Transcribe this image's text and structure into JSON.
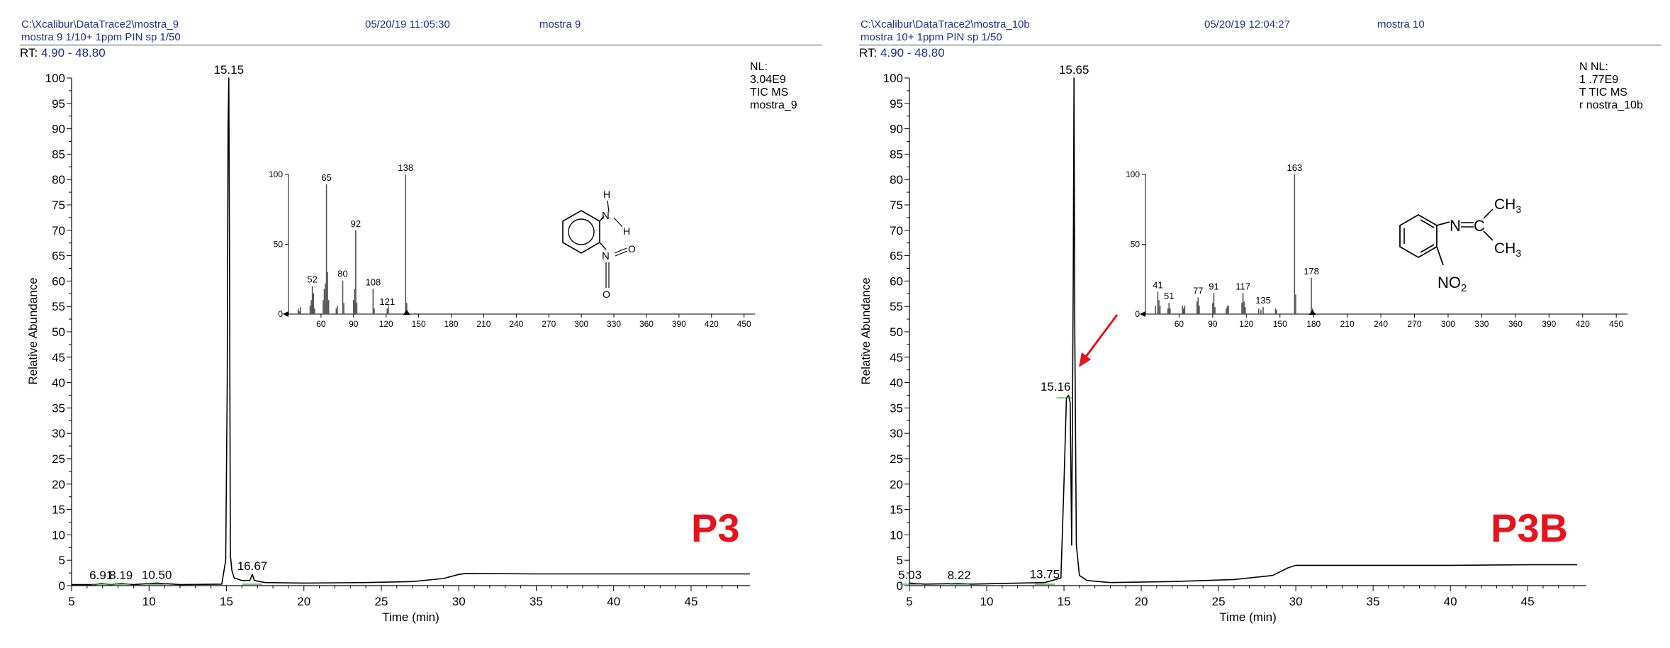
{
  "panels": [
    {
      "file_path": "C:\\Xcalibur\\DataTrace2\\mostra_9",
      "datetime": "05/20/19 11:05:30",
      "sample_name": "mostra 9",
      "description": "mostra 9 1/10+ 1ppm PIN sp 1/50",
      "rt_label": "RT:",
      "rt_range": "4.90 - 48.80",
      "nl_label": "NL:",
      "nl_value": "3.04E9",
      "scan_filter": "TIC  MS",
      "data_file": "mostra_9",
      "big_label": "P3",
      "structure": "2-nitroaniline",
      "chart_data": {
        "type": "line",
        "title": "",
        "xlabel": "Time (min)",
        "ylabel": "Relative Abundance",
        "xlim": [
          5,
          48.8
        ],
        "ylim": [
          0,
          100
        ],
        "xticks": [
          5,
          10,
          15,
          20,
          25,
          30,
          35,
          40,
          45
        ],
        "yticks": [
          0,
          5,
          10,
          15,
          20,
          25,
          30,
          35,
          40,
          45,
          50,
          55,
          60,
          65,
          70,
          75,
          80,
          85,
          90,
          95,
          100
        ],
        "series": [
          {
            "x": [
              5,
              6.5,
              6.91,
              7.5,
              8.19,
              9,
              10.5,
              12,
              14.7,
              14.95,
              15.05,
              15.1,
              15.15,
              15.2,
              15.25,
              15.35,
              15.5,
              16,
              16.5,
              16.67,
              16.8,
              17.5,
              20,
              24,
              27,
              29,
              30,
              30.5,
              35,
              40,
              45,
              48.8
            ],
            "y": [
              0.2,
              0.2,
              0.4,
              0.2,
              0.4,
              0.2,
              0.5,
              0.2,
              0.3,
              5,
              40,
              90,
              100,
              60,
              6,
              3,
              1.5,
              1,
              1,
              2.2,
              1,
              0.6,
              0.5,
              0.6,
              0.8,
              1.4,
              2.2,
              2.4,
              2.3,
              2.3,
              2.3,
              2.3
            ]
          }
        ],
        "peak_labels": [
          {
            "rt": 15.15,
            "abundance": 100,
            "text": "15.15"
          },
          {
            "rt": 6.91,
            "abundance": 0.4,
            "text": "6.91"
          },
          {
            "rt": 8.19,
            "abundance": 0.4,
            "text": "8.19"
          },
          {
            "rt": 10.5,
            "abundance": 0.5,
            "text": "10.50"
          },
          {
            "rt": 16.67,
            "abundance": 2.2,
            "text": "16.67"
          }
        ]
      },
      "inset_chart_data": {
        "type": "bar",
        "xlim": [
          30,
          460
        ],
        "ylim": [
          0,
          100
        ],
        "xticks": [
          60,
          90,
          120,
          150,
          180,
          210,
          240,
          270,
          300,
          330,
          360,
          390,
          420,
          450
        ],
        "yticks": [
          0,
          50,
          100
        ],
        "peaks": [
          {
            "mz": 39,
            "rel": 4
          },
          {
            "mz": 40,
            "rel": 2
          },
          {
            "mz": 41,
            "rel": 5
          },
          {
            "mz": 50,
            "rel": 6
          },
          {
            "mz": 51,
            "rel": 10
          },
          {
            "mz": 52,
            "rel": 20
          },
          {
            "mz": 53,
            "rel": 15
          },
          {
            "mz": 54,
            "rel": 4
          },
          {
            "mz": 62,
            "rel": 10
          },
          {
            "mz": 63,
            "rel": 18
          },
          {
            "mz": 64,
            "rel": 22
          },
          {
            "mz": 65,
            "rel": 93
          },
          {
            "mz": 66,
            "rel": 30
          },
          {
            "mz": 67,
            "rel": 10
          },
          {
            "mz": 74,
            "rel": 4
          },
          {
            "mz": 75,
            "rel": 6
          },
          {
            "mz": 80,
            "rel": 24
          },
          {
            "mz": 81,
            "rel": 8
          },
          {
            "mz": 90,
            "rel": 10
          },
          {
            "mz": 91,
            "rel": 18
          },
          {
            "mz": 92,
            "rel": 60
          },
          {
            "mz": 93,
            "rel": 8
          },
          {
            "mz": 108,
            "rel": 18
          },
          {
            "mz": 109,
            "rel": 4
          },
          {
            "mz": 121,
            "rel": 4
          },
          {
            "mz": 122,
            "rel": 6
          },
          {
            "mz": 138,
            "rel": 100
          },
          {
            "mz": 139,
            "rel": 8
          }
        ],
        "peak_labels": [
          {
            "mz": 52,
            "text": "52"
          },
          {
            "mz": 65,
            "text": "65"
          },
          {
            "mz": 80,
            "text": "80"
          },
          {
            "mz": 92,
            "text": "92"
          },
          {
            "mz": 108,
            "text": "108"
          },
          {
            "mz": 121,
            "text": "121"
          },
          {
            "mz": 138,
            "text": "138"
          }
        ]
      }
    },
    {
      "file_path": "C:\\Xcalibur\\DataTrace2\\mostra_10b",
      "datetime": "05/20/19 12:04:27",
      "sample_name": "mostra 10",
      "description": "mostra 10+ 1ppm PIN sp 1/50",
      "rt_label": "RT:",
      "rt_range": "4.90 - 48.80",
      "nl_label": "N  NL:",
      "nl_value": "1  .77E9",
      "scan_filter": "T  TIC  MS",
      "data_file": "r  nostra_10b",
      "big_label": "P3B",
      "structure": "N-(2-nitrophenyl)propan-2-imine",
      "chart_data": {
        "type": "line",
        "title": "",
        "xlabel": "Time (min)",
        "ylabel": "Relative Abundance",
        "xlim": [
          5,
          48.8
        ],
        "ylim": [
          0,
          100
        ],
        "xticks": [
          5,
          10,
          15,
          20,
          25,
          30,
          35,
          40,
          45
        ],
        "yticks": [
          0,
          5,
          10,
          15,
          20,
          25,
          30,
          35,
          40,
          45,
          50,
          55,
          60,
          65,
          70,
          75,
          80,
          85,
          90,
          95,
          100
        ],
        "series": [
          {
            "x": [
              5,
              5.03,
              6,
              8.22,
              9,
              13.75,
              14.8,
              15.0,
              15.16,
              15.3,
              15.4,
              15.5,
              15.6,
              15.65,
              15.7,
              15.8,
              16.0,
              16.5,
              18,
              22,
              26,
              28.5,
              29.5,
              30,
              35,
              40,
              45,
              48.2
            ],
            "y": [
              0.3,
              0.5,
              0.3,
              0.4,
              0.3,
              0.6,
              1.5,
              20,
              37,
              37.5,
              36,
              8,
              60,
              100,
              50,
              8,
              2,
              1,
              0.6,
              0.8,
              1.2,
              2,
              3.5,
              4,
              4,
              4,
              4.1,
              4.1
            ]
          }
        ],
        "peak_labels": [
          {
            "rt": 15.65,
            "abundance": 100,
            "text": "15.65"
          },
          {
            "rt": 15.16,
            "abundance": 37,
            "text": "15.16"
          },
          {
            "rt": 5.03,
            "abundance": 0.5,
            "text": "5.03"
          },
          {
            "rt": 8.22,
            "abundance": 0.4,
            "text": "8.22"
          },
          {
            "rt": 13.75,
            "abundance": 0.6,
            "text": "13.75"
          }
        ],
        "arrow_target_rt": 15.65,
        "arrow_target_abundance": 37
      },
      "inset_chart_data": {
        "type": "bar",
        "xlim": [
          30,
          460
        ],
        "ylim": [
          0,
          100
        ],
        "xticks": [
          60,
          90,
          120,
          150,
          180,
          210,
          240,
          270,
          300,
          330,
          360,
          390,
          420,
          450
        ],
        "yticks": [
          0,
          50,
          100
        ],
        "peaks": [
          {
            "mz": 39,
            "rel": 6
          },
          {
            "mz": 41,
            "rel": 16
          },
          {
            "mz": 42,
            "rel": 10
          },
          {
            "mz": 43,
            "rel": 6
          },
          {
            "mz": 50,
            "rel": 4
          },
          {
            "mz": 51,
            "rel": 8
          },
          {
            "mz": 52,
            "rel": 4
          },
          {
            "mz": 63,
            "rel": 6
          },
          {
            "mz": 64,
            "rel": 4
          },
          {
            "mz": 65,
            "rel": 6
          },
          {
            "mz": 76,
            "rel": 9
          },
          {
            "mz": 77,
            "rel": 12
          },
          {
            "mz": 78,
            "rel": 6
          },
          {
            "mz": 90,
            "rel": 8
          },
          {
            "mz": 91,
            "rel": 15
          },
          {
            "mz": 92,
            "rel": 5
          },
          {
            "mz": 102,
            "rel": 4
          },
          {
            "mz": 103,
            "rel": 6
          },
          {
            "mz": 104,
            "rel": 6
          },
          {
            "mz": 116,
            "rel": 8
          },
          {
            "mz": 117,
            "rel": 15
          },
          {
            "mz": 118,
            "rel": 9
          },
          {
            "mz": 119,
            "rel": 5
          },
          {
            "mz": 131,
            "rel": 4
          },
          {
            "mz": 133,
            "rel": 3
          },
          {
            "mz": 135,
            "rel": 5
          },
          {
            "mz": 146,
            "rel": 4
          },
          {
            "mz": 147,
            "rel": 3
          },
          {
            "mz": 163,
            "rel": 100
          },
          {
            "mz": 164,
            "rel": 14
          },
          {
            "mz": 178,
            "rel": 26
          },
          {
            "mz": 179,
            "rel": 4
          }
        ],
        "peak_labels": [
          {
            "mz": 41,
            "text": "41"
          },
          {
            "mz": 51,
            "text": "51"
          },
          {
            "mz": 77,
            "text": "77"
          },
          {
            "mz": 91,
            "text": "91"
          },
          {
            "mz": 117,
            "text": "117"
          },
          {
            "mz": 135,
            "text": "135"
          },
          {
            "mz": 163,
            "text": "163"
          },
          {
            "mz": 178,
            "text": "178"
          }
        ]
      }
    }
  ],
  "colors": {
    "header_text": "#1f2f8a",
    "trace": "#000000",
    "big_label": "#e8121b",
    "arrow": "#e8121b",
    "peak_marker": "#2e9e3a"
  }
}
